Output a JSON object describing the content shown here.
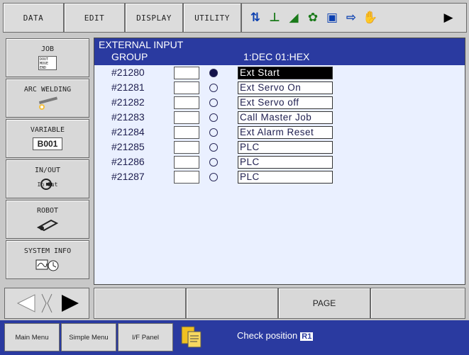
{
  "topbar": {
    "tabs": [
      "DATA",
      "EDIT",
      "DISPLAY",
      "UTILITY"
    ],
    "icons": [
      "axis-mode-icon",
      "coordinate-frame-icon",
      "speed-icon",
      "tool-icon",
      "job-icon",
      "forward-icon",
      "hand-icon",
      "expand-icon"
    ]
  },
  "sidebar": {
    "items": [
      {
        "label": "JOB",
        "sub": "DOUT MOVE END"
      },
      {
        "label": "ARC WELDING",
        "sub": ""
      },
      {
        "label": "VARIABLE",
        "sub": "B001"
      },
      {
        "label": "IN/OUT",
        "sub": "In Out"
      },
      {
        "label": "ROBOT",
        "sub": ""
      },
      {
        "label": "SYSTEM INFO",
        "sub": ""
      }
    ]
  },
  "main": {
    "title": "EXTERNAL INPUT",
    "group_label": "GROUP",
    "format_label": "1:DEC    01:HEX",
    "rows": [
      {
        "num": "#21280",
        "state": "on",
        "label": "Ext Start",
        "selected": true
      },
      {
        "num": "#21281",
        "state": "off",
        "label": "Ext Servo On",
        "selected": false
      },
      {
        "num": "#21282",
        "state": "off",
        "label": "Ext Servo off",
        "selected": false
      },
      {
        "num": "#21283",
        "state": "off",
        "label": "Call Master Job",
        "selected": false
      },
      {
        "num": "#21284",
        "state": "off",
        "label": "Ext Alarm Reset",
        "selected": false
      },
      {
        "num": "#21285",
        "state": "off",
        "label": "PLC",
        "selected": false
      },
      {
        "num": "#21286",
        "state": "off",
        "label": "PLC",
        "selected": false
      },
      {
        "num": "#21287",
        "state": "off",
        "label": "PLC",
        "selected": false
      }
    ]
  },
  "bottom": {
    "buttons": [
      "",
      "",
      "PAGE",
      ""
    ]
  },
  "status": {
    "tabs": [
      "Main Menu",
      "Simple Menu",
      "I/F Panel"
    ],
    "message": "Check position",
    "tag": "R1"
  }
}
